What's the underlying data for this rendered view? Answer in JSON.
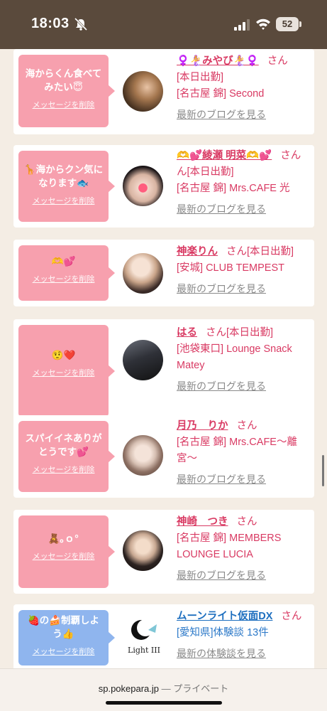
{
  "status": {
    "time": "18:03",
    "battery": "52"
  },
  "url": {
    "domain": "sp.pokepara.jp",
    "sep": " — ",
    "private": "プライベート"
  },
  "delete_label": "メッセージを削除",
  "blog_label": "最新のブログを見る",
  "review_label": "最新の体験談を見る",
  "san": "さん",
  "cards": [
    {
      "msg": "海からくん食べて\nみたい😇",
      "name": "♀️🧜‍♀️みやび🧜‍♀️♀️",
      "line1": "[本日出勤]",
      "line2": "[名古屋 錦] Second",
      "line3": ""
    },
    {
      "msg": "🦒海からクン気に\nなります🐟",
      "name": "🫶💕綾瀬 明菜🫶💕",
      "line1": "ん[本日出勤]",
      "line2": "[名古屋 錦] Mrs.CAFE 光",
      "line3": ""
    },
    {
      "msg": "🫶💕",
      "name": "神楽りん",
      "line1": "[本日出勤]",
      "line2": "[安城] CLUB TEMPEST",
      "line3": ""
    },
    {
      "msg": "🤨❤️",
      "name": "はる",
      "line1": "[本日出勤]",
      "line2": "[池袋東口] Lounge Snack",
      "line3": "Matey"
    },
    {
      "msg": "スパイイネありが\nとうです💕",
      "name": "月乃　りか",
      "line1": "[名古屋 錦] Mrs.CAFE～離",
      "line2": "宮～",
      "line3": ""
    },
    {
      "msg": "🧸｡ｏ°",
      "name": "神崎　つき",
      "line1": "[名古屋 錦] MEMBERS",
      "line2": "LOUNGE LUCIA",
      "line3": ""
    },
    {
      "msg": "🍓の🍰制覇しよ\nう👍",
      "name": "ムーンライト仮面DX",
      "line1": "[愛知県]体験談 13件",
      "line2": "",
      "line3": "",
      "logo": "Light III"
    }
  ]
}
